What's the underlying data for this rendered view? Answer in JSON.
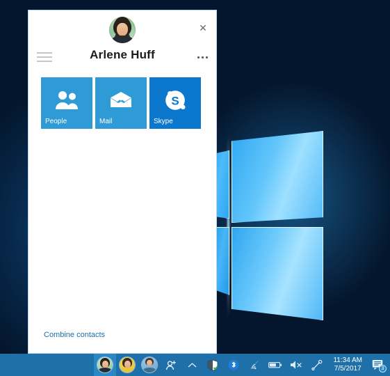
{
  "desktop": {
    "wallpaper_name": "windows-10-hero-logo",
    "background_color": "#04162d",
    "accent_color": "#2b86c4"
  },
  "panel": {
    "title": "Arlene Huff",
    "avatar_name": "arlene-huff-avatar",
    "close_label": "✕",
    "menu_icon_name": "hamburger-icon",
    "more_icon_name": "more-options-icon",
    "tiles": [
      {
        "label": "People",
        "icon": "people-icon",
        "color": "#2e9bd6"
      },
      {
        "label": "Mail",
        "icon": "mail-icon",
        "color": "#2e9bd6"
      },
      {
        "label": "Skype",
        "icon": "skype-icon",
        "color": "#0b78ce"
      }
    ],
    "footer_link": "Combine contacts",
    "footer_link_color": "#1c6ea8"
  },
  "taskbar": {
    "background_color": "#1f6fa8",
    "people_bar": [
      {
        "name": "pinned-contact-1",
        "active": true
      },
      {
        "name": "pinned-contact-2",
        "active": false
      },
      {
        "name": "pinned-contact-3",
        "active": false
      }
    ],
    "add_contact_icon": "add-person-icon",
    "show_hidden_icon": "chevron-up-icon",
    "tray": [
      {
        "name": "security-shield-icon",
        "glyph": "shield"
      },
      {
        "name": "bluetooth-icon",
        "glyph": "bluetooth"
      },
      {
        "name": "wifi-icon",
        "glyph": "wifi"
      },
      {
        "name": "battery-icon",
        "glyph": "battery"
      },
      {
        "name": "volume-muted-icon",
        "glyph": "volume-mute"
      },
      {
        "name": "pen-workspace-icon",
        "glyph": "pen"
      }
    ],
    "clock": {
      "time": "11:34 AM",
      "date": "7/5/2017"
    },
    "notifications": {
      "icon": "action-center-icon",
      "count": "3"
    }
  }
}
